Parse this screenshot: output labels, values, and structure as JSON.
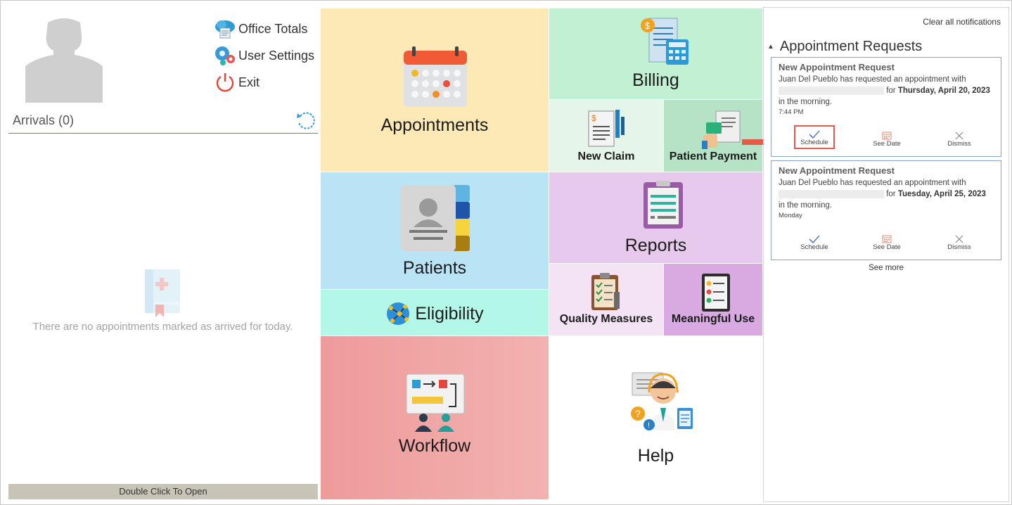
{
  "left": {
    "links": [
      {
        "label": "Office Totals",
        "icon": "cloud-icon"
      },
      {
        "label": "User Settings",
        "icon": "gears-icon"
      },
      {
        "label": "Exit",
        "icon": "power-icon"
      }
    ],
    "arrivals_title": "Arrivals (0)",
    "empty_message": "There are no appointments marked as arrived for today.",
    "open_bar": "Double Click To Open"
  },
  "tiles": {
    "appointments": "Appointments",
    "billing": "Billing",
    "new_claim": "New Claim",
    "patient_payment": "Patient Payment",
    "patients": "Patients",
    "eligibility": "Eligibility",
    "reports": "Reports",
    "quality_measures": "Quality Measures",
    "meaningful_use": "Meaningful Use",
    "workflow": "Workflow",
    "help": "Help"
  },
  "notifications": {
    "clear_all": "Clear all notifications",
    "heading": "Appointment Requests",
    "cards": [
      {
        "title": "New Appointment Request",
        "name": "Juan  Del Pueblo",
        "text": "has requested an appointment with",
        "for": "for",
        "date": "Thursday, April 20, 2023",
        "period": "in the morning.",
        "time": "7:44 PM",
        "actions": [
          "Schedule",
          "See Date",
          "Dismiss"
        ]
      },
      {
        "title": "New Appointment Request",
        "name": "Juan  Del Pueblo",
        "text": "has requested an appointment with",
        "for": "for",
        "date": "Tuesday, April 25, 2023",
        "period": "in the morning.",
        "time": "Monday",
        "actions": [
          "Schedule",
          "See Date",
          "Dismiss"
        ]
      }
    ],
    "see_more": "See more"
  },
  "colors": {
    "appointments": "#fde9b6",
    "billing": "#c2f0d3",
    "patients": "#b9e4f6",
    "eligibility": "#b3f7e9",
    "reports": "#e6c9ec",
    "workflow": "#ee9b9a",
    "highlight": "#e05a4f"
  }
}
